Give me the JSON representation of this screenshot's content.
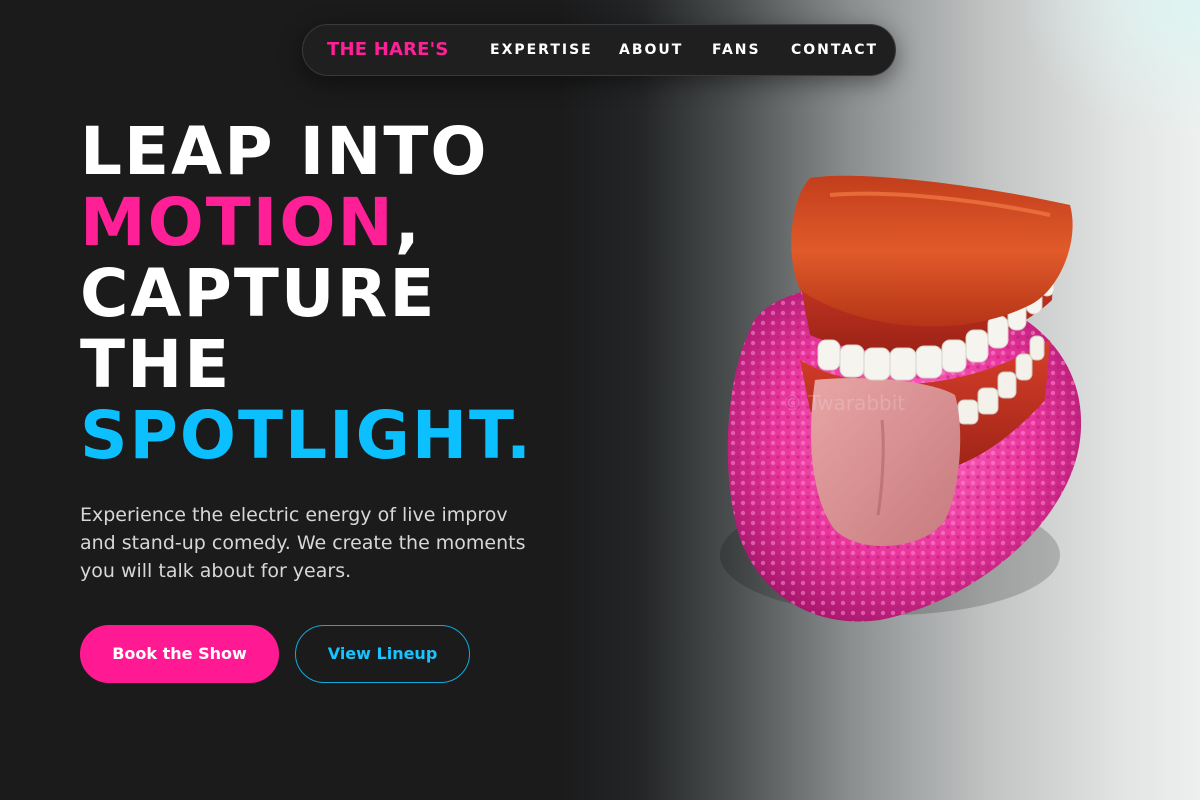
{
  "nav": {
    "brand": "THE HARE'S",
    "links": [
      "EXPERTISE",
      "ABOUT",
      "FANS",
      "CONTACT"
    ]
  },
  "hero": {
    "headline": {
      "line1": "LEAP INTO",
      "line2_highlight": "MOTION",
      "line2_punct": ",",
      "line3": "CAPTURE",
      "line4": "THE",
      "line5_highlight": "SPOTLIGHT."
    },
    "description": "Experience the electric energy of live improv and stand-up comedy. We create the moments you will talk about for years.",
    "primary_button": "Book the Show",
    "secondary_button": "View Lineup",
    "image_watermark": "© Twarabbit"
  },
  "colors": {
    "background": "#1b1b1c",
    "accent_pink": "#ff1f96",
    "accent_blue": "#0cc0ff",
    "text": "#ffffff"
  },
  "icons": {
    "hero_image": "wind-up-chattering-teeth-toy"
  }
}
